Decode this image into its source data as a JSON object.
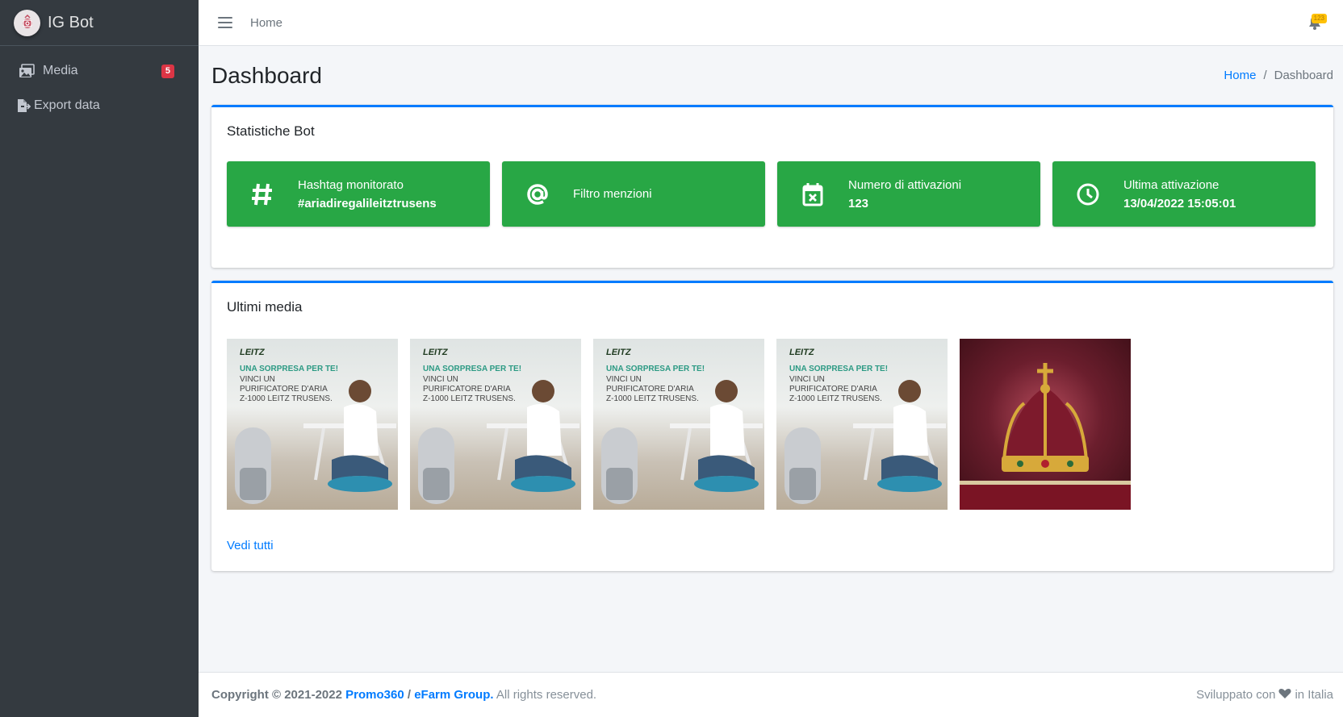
{
  "brand": {
    "title": "IG Bot"
  },
  "sidebar": {
    "items": [
      {
        "label": "Media",
        "badge": "5",
        "icon": "images-icon"
      },
      {
        "label": "Export data",
        "icon": "file-export-icon"
      }
    ]
  },
  "topnav": {
    "home_label": "Home",
    "notification_count": "123"
  },
  "header": {
    "title": "Dashboard",
    "breadcrumb": {
      "home": "Home",
      "separator": "/",
      "current": "Dashboard"
    }
  },
  "stats_card": {
    "title": "Statistiche Bot",
    "boxes": [
      {
        "icon": "hashtag-icon",
        "label": "Hashtag monitorato",
        "value": "#ariadiregalileitztrusens"
      },
      {
        "icon": "at-icon",
        "label": "Filtro menzioni",
        "value": ""
      },
      {
        "icon": "calendar-x-icon",
        "label": "Numero di attivazioni",
        "value": "123"
      },
      {
        "icon": "clock-icon",
        "label": "Ultima attivazione",
        "value": "13/04/2022 15:05:01"
      }
    ]
  },
  "media_card": {
    "title": "Ultimi media",
    "ad_logo": "LEITZ",
    "ad_headline": "UNA SORPRESA PER TE!",
    "ad_body": "VINCI UN PURIFICATORE D'ARIA Z-1000 LEITZ TRUSENS.",
    "see_all": "Vedi tutti"
  },
  "footer": {
    "copyright": "Copyright © 2021-2022",
    "company1": "Promo360",
    "sep": "/",
    "company2": "eFarm Group.",
    "rights": "All rights reserved.",
    "dev_prefix": "Sviluppato con",
    "dev_suffix": "in Italia"
  },
  "colors": {
    "sidebar": "#343a40",
    "accent": "#007bff",
    "success": "#28a745",
    "danger": "#dc3545",
    "warning": "#ffc107"
  }
}
